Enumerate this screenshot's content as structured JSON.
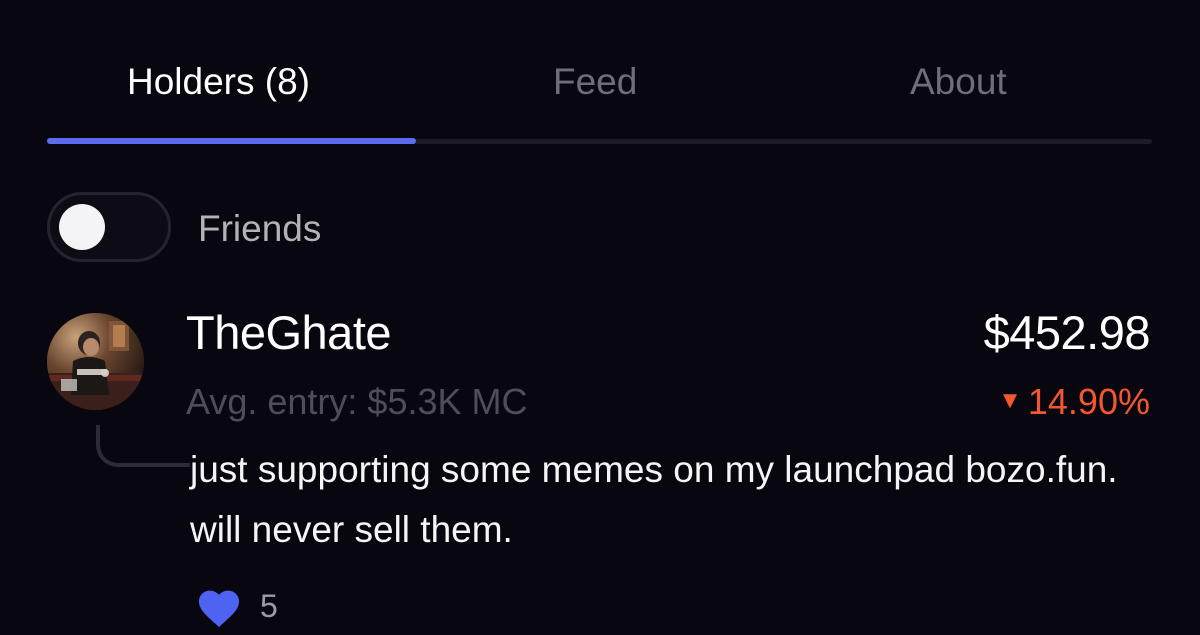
{
  "tabs": {
    "holders": "Holders (8)",
    "feed": "Feed",
    "about": "About",
    "active": "holders"
  },
  "filter": {
    "label": "Friends",
    "enabled": false
  },
  "holder": {
    "username": "TheGhate",
    "avg_entry": "Avg. entry: $5.3K MC",
    "value": "$452.98",
    "change": "14.90%",
    "change_direction": "down",
    "comment": "just supporting some memes on my launchpad bozo.fun. will never sell them.",
    "likes": "5"
  },
  "colors": {
    "background": "#08060f",
    "accent": "#5b6cf0",
    "negative": "#f4562f",
    "like": "#4f63f2"
  },
  "icons": {
    "avatar": "avatar-image",
    "change": "triangle-down-icon",
    "like": "heart-icon"
  }
}
